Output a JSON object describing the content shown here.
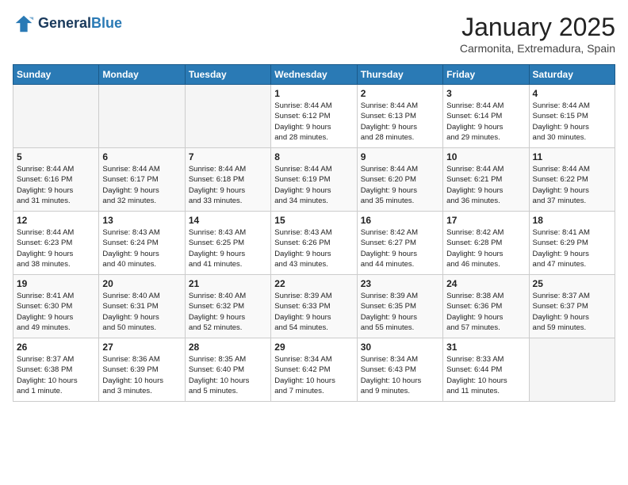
{
  "header": {
    "logo_line1": "General",
    "logo_line2": "Blue",
    "month": "January 2025",
    "location": "Carmonita, Extremadura, Spain"
  },
  "days_of_week": [
    "Sunday",
    "Monday",
    "Tuesday",
    "Wednesday",
    "Thursday",
    "Friday",
    "Saturday"
  ],
  "weeks": [
    [
      {
        "day": "",
        "info": ""
      },
      {
        "day": "",
        "info": ""
      },
      {
        "day": "",
        "info": ""
      },
      {
        "day": "1",
        "info": "Sunrise: 8:44 AM\nSunset: 6:12 PM\nDaylight: 9 hours\nand 28 minutes."
      },
      {
        "day": "2",
        "info": "Sunrise: 8:44 AM\nSunset: 6:13 PM\nDaylight: 9 hours\nand 28 minutes."
      },
      {
        "day": "3",
        "info": "Sunrise: 8:44 AM\nSunset: 6:14 PM\nDaylight: 9 hours\nand 29 minutes."
      },
      {
        "day": "4",
        "info": "Sunrise: 8:44 AM\nSunset: 6:15 PM\nDaylight: 9 hours\nand 30 minutes."
      }
    ],
    [
      {
        "day": "5",
        "info": "Sunrise: 8:44 AM\nSunset: 6:16 PM\nDaylight: 9 hours\nand 31 minutes."
      },
      {
        "day": "6",
        "info": "Sunrise: 8:44 AM\nSunset: 6:17 PM\nDaylight: 9 hours\nand 32 minutes."
      },
      {
        "day": "7",
        "info": "Sunrise: 8:44 AM\nSunset: 6:18 PM\nDaylight: 9 hours\nand 33 minutes."
      },
      {
        "day": "8",
        "info": "Sunrise: 8:44 AM\nSunset: 6:19 PM\nDaylight: 9 hours\nand 34 minutes."
      },
      {
        "day": "9",
        "info": "Sunrise: 8:44 AM\nSunset: 6:20 PM\nDaylight: 9 hours\nand 35 minutes."
      },
      {
        "day": "10",
        "info": "Sunrise: 8:44 AM\nSunset: 6:21 PM\nDaylight: 9 hours\nand 36 minutes."
      },
      {
        "day": "11",
        "info": "Sunrise: 8:44 AM\nSunset: 6:22 PM\nDaylight: 9 hours\nand 37 minutes."
      }
    ],
    [
      {
        "day": "12",
        "info": "Sunrise: 8:44 AM\nSunset: 6:23 PM\nDaylight: 9 hours\nand 38 minutes."
      },
      {
        "day": "13",
        "info": "Sunrise: 8:43 AM\nSunset: 6:24 PM\nDaylight: 9 hours\nand 40 minutes."
      },
      {
        "day": "14",
        "info": "Sunrise: 8:43 AM\nSunset: 6:25 PM\nDaylight: 9 hours\nand 41 minutes."
      },
      {
        "day": "15",
        "info": "Sunrise: 8:43 AM\nSunset: 6:26 PM\nDaylight: 9 hours\nand 43 minutes."
      },
      {
        "day": "16",
        "info": "Sunrise: 8:42 AM\nSunset: 6:27 PM\nDaylight: 9 hours\nand 44 minutes."
      },
      {
        "day": "17",
        "info": "Sunrise: 8:42 AM\nSunset: 6:28 PM\nDaylight: 9 hours\nand 46 minutes."
      },
      {
        "day": "18",
        "info": "Sunrise: 8:41 AM\nSunset: 6:29 PM\nDaylight: 9 hours\nand 47 minutes."
      }
    ],
    [
      {
        "day": "19",
        "info": "Sunrise: 8:41 AM\nSunset: 6:30 PM\nDaylight: 9 hours\nand 49 minutes."
      },
      {
        "day": "20",
        "info": "Sunrise: 8:40 AM\nSunset: 6:31 PM\nDaylight: 9 hours\nand 50 minutes."
      },
      {
        "day": "21",
        "info": "Sunrise: 8:40 AM\nSunset: 6:32 PM\nDaylight: 9 hours\nand 52 minutes."
      },
      {
        "day": "22",
        "info": "Sunrise: 8:39 AM\nSunset: 6:33 PM\nDaylight: 9 hours\nand 54 minutes."
      },
      {
        "day": "23",
        "info": "Sunrise: 8:39 AM\nSunset: 6:35 PM\nDaylight: 9 hours\nand 55 minutes."
      },
      {
        "day": "24",
        "info": "Sunrise: 8:38 AM\nSunset: 6:36 PM\nDaylight: 9 hours\nand 57 minutes."
      },
      {
        "day": "25",
        "info": "Sunrise: 8:37 AM\nSunset: 6:37 PM\nDaylight: 9 hours\nand 59 minutes."
      }
    ],
    [
      {
        "day": "26",
        "info": "Sunrise: 8:37 AM\nSunset: 6:38 PM\nDaylight: 10 hours\nand 1 minute."
      },
      {
        "day": "27",
        "info": "Sunrise: 8:36 AM\nSunset: 6:39 PM\nDaylight: 10 hours\nand 3 minutes."
      },
      {
        "day": "28",
        "info": "Sunrise: 8:35 AM\nSunset: 6:40 PM\nDaylight: 10 hours\nand 5 minutes."
      },
      {
        "day": "29",
        "info": "Sunrise: 8:34 AM\nSunset: 6:42 PM\nDaylight: 10 hours\nand 7 minutes."
      },
      {
        "day": "30",
        "info": "Sunrise: 8:34 AM\nSunset: 6:43 PM\nDaylight: 10 hours\nand 9 minutes."
      },
      {
        "day": "31",
        "info": "Sunrise: 8:33 AM\nSunset: 6:44 PM\nDaylight: 10 hours\nand 11 minutes."
      },
      {
        "day": "",
        "info": ""
      }
    ]
  ]
}
